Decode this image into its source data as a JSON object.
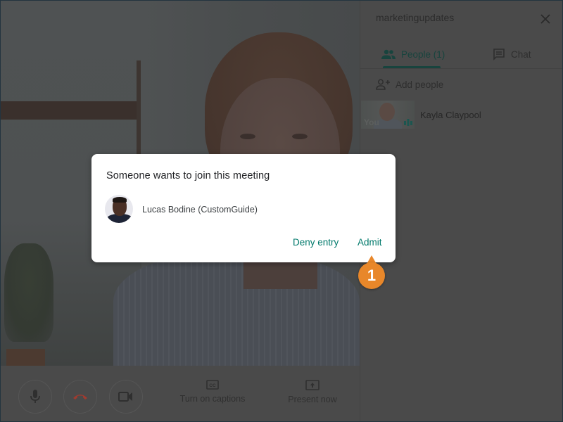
{
  "sidebar": {
    "meeting_name": "marketingupdates",
    "tabs": [
      {
        "label": "People (1)",
        "icon": "people-icon",
        "active": true
      },
      {
        "label": "Chat",
        "icon": "chat-icon",
        "active": false
      }
    ],
    "add_people_label": "Add people",
    "participants": [
      {
        "name": "Kayla Claypool",
        "thumb_label": "You"
      }
    ]
  },
  "dialog": {
    "title": "Someone wants to join this meeting",
    "requester_name": "Lucas Bodine (CustomGuide)",
    "deny_label": "Deny entry",
    "admit_label": "Admit"
  },
  "controls": {
    "captions_label": "Turn on captions",
    "present_label": "Present now"
  },
  "callout": {
    "step": "1"
  },
  "colors": {
    "accent_teal": "#00796b",
    "callout_orange": "#e8872a",
    "hangup_red": "#a03b2f"
  }
}
